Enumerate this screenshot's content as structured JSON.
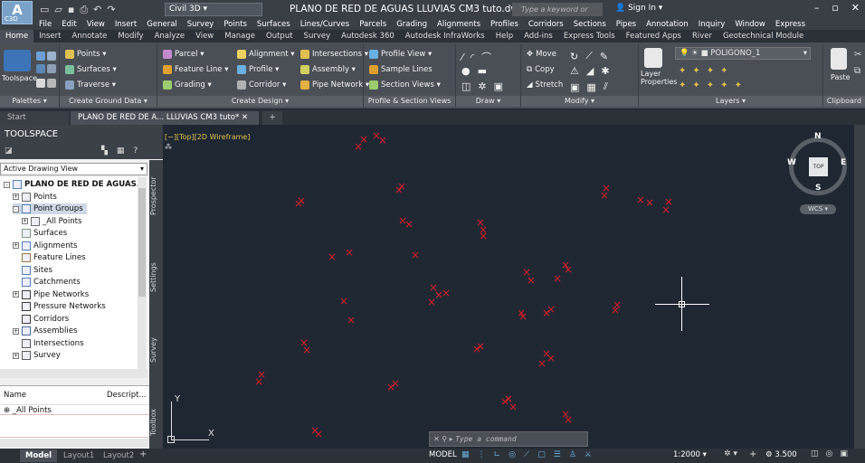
{
  "titlebar": {
    "app_short": "C3D",
    "workspace": "Civil 3D",
    "doc_title": "PLANO DE RED DE AGUAS LLUVIAS CM3 tuto.dwg",
    "search_placeholder": "Type a keyword or phrase",
    "sign_in": "Sign In"
  },
  "menubar": [
    "File",
    "Edit",
    "View",
    "Insert",
    "General",
    "Survey",
    "Points",
    "Surfaces",
    "Lines/Curves",
    "Parcels",
    "Grading",
    "Alignments",
    "Profiles",
    "Corridors",
    "Sections",
    "Pipes",
    "Annotation",
    "Inquiry",
    "Window",
    "Express"
  ],
  "ribbon_tabs": [
    "Home",
    "Insert",
    "Annotate",
    "Modify",
    "Analyze",
    "View",
    "Manage",
    "Output",
    "Survey",
    "Autodesk 360",
    "Autodesk InfraWorks",
    "Help",
    "Add-ins",
    "Express Tools",
    "Featured Apps",
    "River",
    "Geotechnical Module"
  ],
  "ribbon": {
    "toolspace_label": "Toolspace",
    "palettes": "Palettes ▾",
    "ground": {
      "points": "Points ▾",
      "surfaces": "Surfaces ▾",
      "traverse": "Traverse ▾",
      "title": "Create Ground Data ▾"
    },
    "design": {
      "parcel": "Parcel ▾",
      "feature_line": "Feature Line ▾",
      "grading": "Grading ▾",
      "alignment": "Alignment ▾",
      "profile": "Profile ▾",
      "corridor": "Corridor ▾",
      "intersections": "Intersections ▾",
      "assembly": "Assembly ▾",
      "pipe_network": "Pipe Network ▾",
      "title": "Create Design ▾"
    },
    "profile_section": {
      "profile_view": "Profile View ▾",
      "sample_lines": "Sample Lines",
      "section_views": "Section Views ▾",
      "title": "Profile & Section Views"
    },
    "draw": {
      "title": "Draw ▾"
    },
    "modify": {
      "move": "Move",
      "copy": "Copy",
      "stretch": "Stretch",
      "title": "Modify ▾"
    },
    "layers": {
      "layer_name": "POLIGONO_1",
      "layer_properties": "Layer Properties",
      "title": "Layers ▾"
    },
    "clipboard": {
      "paste": "Paste",
      "title": "Clipboard"
    }
  },
  "doc_tabs": {
    "start": "Start",
    "active": "PLANO DE RED DE A... LLUVIAS CM3 tuto*"
  },
  "toolspace": {
    "title": "TOOLSPACE",
    "view_select": "Active Drawing View",
    "tree": [
      {
        "label": "PLANO DE RED DE AGUAS...",
        "level": 0,
        "exp": "-"
      },
      {
        "label": "Points",
        "level": 1,
        "exp": "+"
      },
      {
        "label": "Point Groups",
        "level": 1,
        "exp": "-"
      },
      {
        "label": "_All Points",
        "level": 2,
        "exp": "+"
      },
      {
        "label": "Surfaces",
        "level": 1,
        "exp": ""
      },
      {
        "label": "Alignments",
        "level": 1,
        "exp": "+"
      },
      {
        "label": "Feature Lines",
        "level": 1,
        "exp": ""
      },
      {
        "label": "Sites",
        "level": 1,
        "exp": ""
      },
      {
        "label": "Catchments",
        "level": 1,
        "exp": ""
      },
      {
        "label": "Pipe Networks",
        "level": 1,
        "exp": "+"
      },
      {
        "label": "Pressure Networks",
        "level": 1,
        "exp": ""
      },
      {
        "label": "Corridors",
        "level": 1,
        "exp": ""
      },
      {
        "label": "Assemblies",
        "level": 1,
        "exp": "+"
      },
      {
        "label": "Intersections",
        "level": 1,
        "exp": ""
      },
      {
        "label": "Survey",
        "level": 1,
        "exp": "+"
      }
    ],
    "side_tabs": [
      "Prospector",
      "Settings",
      "Survey",
      "Toolbox"
    ],
    "props_headers": [
      "Name",
      "Descript..."
    ],
    "props_row": "_All Points"
  },
  "viewport": {
    "label": "[−][Top][2D Wireframe]",
    "viewcube": {
      "top": "TOP",
      "n": "N",
      "s": "S",
      "e": "E",
      "w": "W"
    },
    "wcs": "WCS",
    "ucs_y": "Y",
    "ucs_x": "X",
    "command_placeholder": "Type a command"
  },
  "statusbar": {
    "tabs": [
      "Model",
      "Layout1",
      "Layout2"
    ],
    "model": "MODEL",
    "scale": "1:2000 ▾",
    "value": "3.500"
  }
}
